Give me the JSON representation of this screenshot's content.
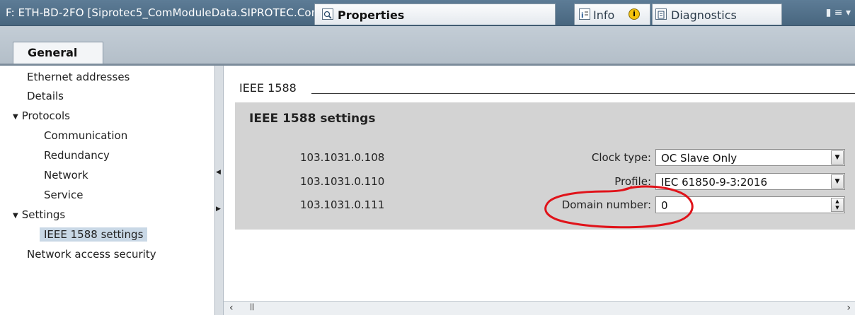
{
  "window": {
    "title": "F: ETH-BD-2FO [Siprotec5_ComModuleData.SIPROTEC.ComM...",
    "controls": "▮ ≡ ▾"
  },
  "inspector_tabs": [
    {
      "label": "Properties",
      "icon": "properties-icon",
      "active": true
    },
    {
      "label": "Info",
      "icon": "info-icon",
      "badge": "i"
    },
    {
      "label": "Diagnostics",
      "icon": "diagnostics-icon"
    }
  ],
  "general_tab": {
    "label": "General"
  },
  "nav": {
    "items": [
      {
        "label": "Ethernet addresses"
      },
      {
        "label": "Details"
      },
      {
        "label": "Protocols",
        "expanded": true
      },
      {
        "label": "Communication"
      },
      {
        "label": "Redundancy"
      },
      {
        "label": "Network"
      },
      {
        "label": "Service"
      },
      {
        "label": "Settings",
        "expanded": true
      },
      {
        "label": "IEEE 1588 settings",
        "selected": true
      },
      {
        "label": "Network access security"
      }
    ]
  },
  "section": {
    "title": "IEEE 1588",
    "box_heading": "IEEE 1588 settings",
    "rows": [
      {
        "param": "103.1031.0.108",
        "label": "Clock type:",
        "value": "OC Slave Only",
        "control": "dropdown"
      },
      {
        "param": "103.1031.0.110",
        "label": "Profile:",
        "value": "IEC 61850-9-3:2016",
        "control": "dropdown"
      },
      {
        "param": "103.1031.0.111",
        "label": "Domain number:",
        "value": "0",
        "control": "spinner"
      }
    ]
  },
  "colors": {
    "titlebar": "#48667f",
    "tab_strip": "#b3bec8",
    "settings_box": "#d3d3d3",
    "selected_nav": "#c9d8e6",
    "annotation": "#e0131a"
  },
  "annotation": {
    "shape": "red-hand-drawn-circle",
    "target": "Domain number field"
  },
  "scrollbar": {
    "left": "‹",
    "grip": "|||",
    "right": "›"
  }
}
